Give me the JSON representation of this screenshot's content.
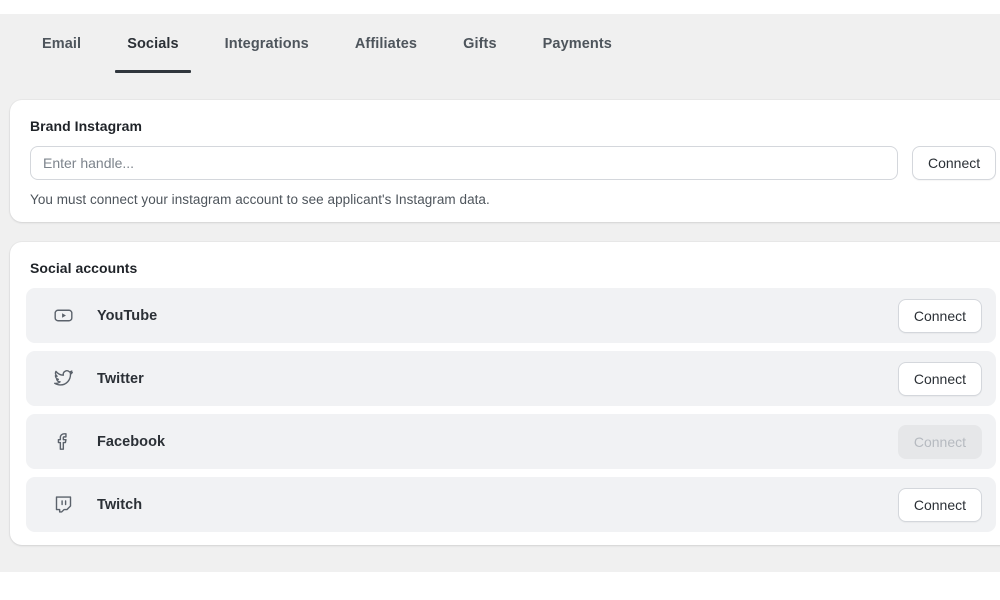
{
  "tabs": [
    {
      "label": "Email",
      "active": false
    },
    {
      "label": "Socials",
      "active": true
    },
    {
      "label": "Integrations",
      "active": false
    },
    {
      "label": "Affiliates",
      "active": false
    },
    {
      "label": "Gifts",
      "active": false
    },
    {
      "label": "Payments",
      "active": false
    }
  ],
  "instagram_card": {
    "title": "Brand Instagram",
    "input_placeholder": "Enter handle...",
    "input_value": "",
    "connect_label": "Connect",
    "help_text": "You must connect your instagram account to see applicant's Instagram data."
  },
  "socials_card": {
    "title": "Social accounts",
    "accounts": [
      {
        "name": "YouTube",
        "icon": "youtube-icon",
        "button_label": "Connect",
        "disabled": false
      },
      {
        "name": "Twitter",
        "icon": "twitter-icon",
        "button_label": "Connect",
        "disabled": false
      },
      {
        "name": "Facebook",
        "icon": "facebook-icon",
        "button_label": "Connect",
        "disabled": true
      },
      {
        "name": "Twitch",
        "icon": "twitch-icon",
        "button_label": "Connect",
        "disabled": false
      }
    ]
  },
  "colors": {
    "page_background": "#f0f0f0",
    "card_background": "#ffffff",
    "row_background": "#f1f2f4",
    "active_tab_underline": "#30363d",
    "text_primary": "#2b3036",
    "text_secondary": "#4e555c",
    "disabled_text": "#b6bac0",
    "disabled_button": "#e6e7e9",
    "border": "#d4d7dc"
  }
}
